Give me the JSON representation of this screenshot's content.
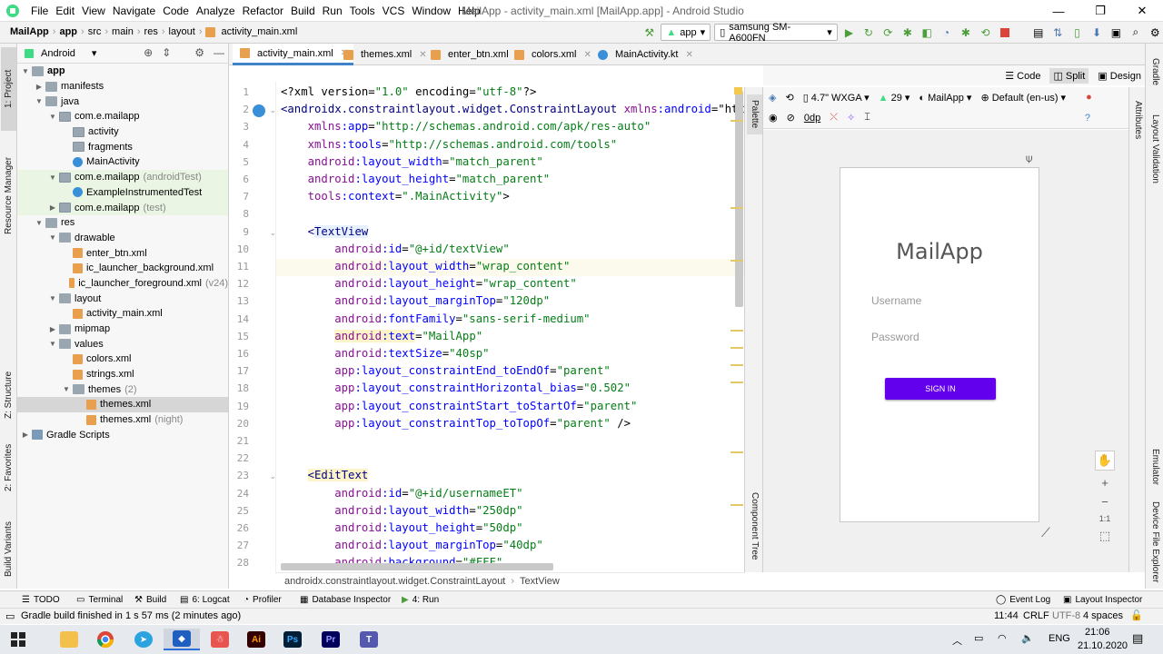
{
  "menubar": {
    "items": [
      "File",
      "Edit",
      "View",
      "Navigate",
      "Code",
      "Analyze",
      "Refactor",
      "Build",
      "Run",
      "Tools",
      "VCS",
      "Window",
      "Help"
    ],
    "window_title": "MailApp - activity_main.xml [MailApp.app] - Android Studio"
  },
  "navbar": {
    "crumbs": [
      "MailApp",
      "app",
      "src",
      "main",
      "res",
      "layout",
      "activity_main.xml"
    ],
    "run_config": "app",
    "device": "samsung SM-A600FN"
  },
  "left_tabs": [
    "1: Project",
    "Resource Manager",
    "Z: Structure",
    "2: Favorites",
    "Build Variants"
  ],
  "right_tabs": [
    "Gradle",
    "Layout Validation",
    "Emulator",
    "Device File Explorer"
  ],
  "project": {
    "view": "Android",
    "tree": [
      {
        "label": "app",
        "muted": "",
        "depth": 0,
        "icon": "folder",
        "arrow": "▼",
        "bold": true
      },
      {
        "label": "manifests",
        "muted": "",
        "depth": 1,
        "icon": "folder",
        "arrow": "▶"
      },
      {
        "label": "java",
        "muted": "",
        "depth": 1,
        "icon": "folder",
        "arrow": "▼"
      },
      {
        "label": "com.e.mailapp",
        "muted": "",
        "depth": 2,
        "icon": "pkg",
        "arrow": "▼"
      },
      {
        "label": "activity",
        "muted": "",
        "depth": 3,
        "icon": "pkg",
        "arrow": ""
      },
      {
        "label": "fragments",
        "muted": "",
        "depth": 3,
        "icon": "pkg",
        "arrow": ""
      },
      {
        "label": "MainActivity",
        "muted": "",
        "depth": 3,
        "icon": "class",
        "arrow": ""
      },
      {
        "label": "com.e.mailapp",
        "muted": "(androidTest)",
        "depth": 2,
        "icon": "pkg",
        "arrow": "▼",
        "green": true
      },
      {
        "label": "ExampleInstrumentedTest",
        "muted": "",
        "depth": 3,
        "icon": "class",
        "arrow": "",
        "green": true
      },
      {
        "label": "com.e.mailapp",
        "muted": "(test)",
        "depth": 2,
        "icon": "pkg",
        "arrow": "▶",
        "green": true
      },
      {
        "label": "res",
        "muted": "",
        "depth": 1,
        "icon": "res",
        "arrow": "▼"
      },
      {
        "label": "drawable",
        "muted": "",
        "depth": 2,
        "icon": "folder",
        "arrow": "▼"
      },
      {
        "label": "enter_btn.xml",
        "muted": "",
        "depth": 3,
        "icon": "xml",
        "arrow": ""
      },
      {
        "label": "ic_launcher_background.xml",
        "muted": "",
        "depth": 3,
        "icon": "xml",
        "arrow": ""
      },
      {
        "label": "ic_launcher_foreground.xml",
        "muted": "(v24)",
        "depth": 3,
        "icon": "xml",
        "arrow": ""
      },
      {
        "label": "layout",
        "muted": "",
        "depth": 2,
        "icon": "folder",
        "arrow": "▼"
      },
      {
        "label": "activity_main.xml",
        "muted": "",
        "depth": 3,
        "icon": "xml",
        "arrow": ""
      },
      {
        "label": "mipmap",
        "muted": "",
        "depth": 2,
        "icon": "folder",
        "arrow": "▶"
      },
      {
        "label": "values",
        "muted": "",
        "depth": 2,
        "icon": "folder",
        "arrow": "▼"
      },
      {
        "label": "colors.xml",
        "muted": "",
        "depth": 3,
        "icon": "xml",
        "arrow": ""
      },
      {
        "label": "strings.xml",
        "muted": "",
        "depth": 3,
        "icon": "xml",
        "arrow": ""
      },
      {
        "label": "themes",
        "muted": "(2)",
        "depth": 3,
        "icon": "folder",
        "arrow": "▼"
      },
      {
        "label": "themes.xml",
        "muted": "",
        "depth": 4,
        "icon": "xml",
        "arrow": "",
        "selected": true
      },
      {
        "label": "themes.xml",
        "muted": "(night)",
        "depth": 4,
        "icon": "xml",
        "arrow": ""
      },
      {
        "label": "Gradle Scripts",
        "muted": "",
        "depth": 0,
        "icon": "gradle",
        "arrow": "▶"
      }
    ]
  },
  "tabs": [
    {
      "label": "activity_main.xml",
      "icon": "xml",
      "active": true
    },
    {
      "label": "themes.xml",
      "icon": "xml"
    },
    {
      "label": "enter_btn.xml",
      "icon": "xml"
    },
    {
      "label": "colors.xml",
      "icon": "xml"
    },
    {
      "label": "MainActivity.kt",
      "icon": "class"
    }
  ],
  "code_lines": [
    "<?xml version=\"1.0\" encoding=\"utf-8\"?>",
    "<androidx.constraintlayout.widget.ConstraintLayout xmlns:android=\"htt",
    "    xmlns:app=\"http://schemas.android.com/apk/res-auto\"",
    "    xmlns:tools=\"http://schemas.android.com/tools\"",
    "    android:layout_width=\"match_parent\"",
    "    android:layout_height=\"match_parent\"",
    "    tools:context=\".MainActivity\">",
    "",
    "    <TextView",
    "        android:id=\"@+id/textView\"",
    "        android:layout_width=\"wrap_content\"",
    "        android:layout_height=\"wrap_content\"",
    "        android:layout_marginTop=\"120dp\"",
    "        android:fontFamily=\"sans-serif-medium\"",
    "        android:text=\"MailApp\"",
    "        android:textSize=\"40sp\"",
    "        app:layout_constraintEnd_toEndOf=\"parent\"",
    "        app:layout_constraintHorizontal_bias=\"0.502\"",
    "        app:layout_constraintStart_toStartOf=\"parent\"",
    "        app:layout_constraintTop_toTopOf=\"parent\" />",
    "",
    "",
    "    <EditText",
    "        android:id=\"@+id/usernameET\"",
    "        android:layout_width=\"250dp\"",
    "        android:layout_height=\"50dp\"",
    "        android:layout_marginTop=\"40dp\"",
    "        android:background=\"#FFF\""
  ],
  "editor_breadcrumb": [
    "androidx.constraintlayout.widget.ConstraintLayout",
    "TextView"
  ],
  "view_modes": {
    "code": "Code",
    "split": "Split",
    "design": "Design"
  },
  "design_toolbar": {
    "device": "4.7\" WXGA",
    "api": "29",
    "theme": "MailApp",
    "locale": "Default (en-us)",
    "margin": "0dp"
  },
  "side_labels": {
    "palette": "Palette",
    "component_tree": "Component Tree",
    "attributes": "Attributes"
  },
  "preview": {
    "title": "MailApp",
    "username_hint": "Username",
    "password_hint": "Password",
    "button_label": "SIGN IN",
    "button_color": "#6200ee"
  },
  "zoom": {
    "fit_label": "1:1"
  },
  "bottom_tools": [
    {
      "label": "TODO"
    },
    {
      "label": "Terminal"
    },
    {
      "label": "Build"
    },
    {
      "label": "6: Logcat"
    },
    {
      "label": "Profiler"
    },
    {
      "label": "Database Inspector"
    },
    {
      "label": "4: Run"
    }
  ],
  "bottom_right_tools": [
    {
      "label": "Event Log"
    },
    {
      "label": "Layout Inspector"
    }
  ],
  "status": {
    "message": "Gradle build finished in 1 s 57 ms (2 minutes ago)",
    "position": "11:44",
    "line_sep": "CRLF",
    "encoding": "UTF-8",
    "indent": "4 spaces"
  },
  "taskbar": {
    "lang": "ENG",
    "time": "21:06",
    "date": "21.10.2020"
  }
}
